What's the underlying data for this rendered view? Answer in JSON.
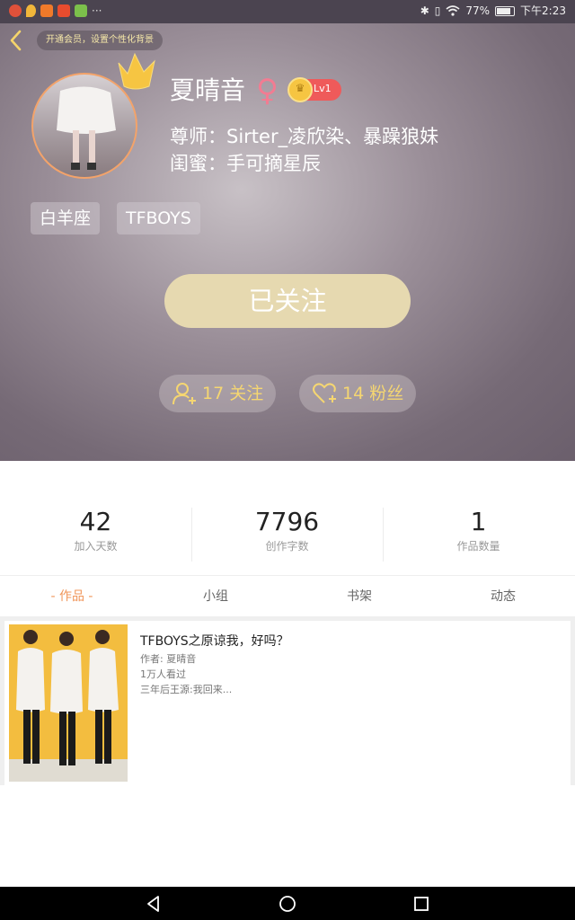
{
  "status_bar": {
    "left_icons": [
      "music-app-icon",
      "location-icon",
      "video-app-icon",
      "orange-app-icon",
      "green-app-icon"
    ],
    "overflow": "···",
    "battery_percent": "77%",
    "time": "下午2:23"
  },
  "header": {
    "vip_tip": "开通会员，设置个性化背景",
    "username": "夏晴音",
    "gender_symbol": "♀",
    "level": "Lv1",
    "mentor_line": "尊师：Sirter_凌欣染、暴躁狼妹",
    "bestie_line": "闺蜜：手可摘星辰",
    "tags": [
      "白羊座",
      "TFBOYS"
    ],
    "follow_button": "已关注",
    "following_count": "17 关注",
    "fans_count": "14 粉丝"
  },
  "stats": [
    {
      "value": "42",
      "label": "加入天数"
    },
    {
      "value": "7796",
      "label": "创作字数"
    },
    {
      "value": "1",
      "label": "作品数量"
    }
  ],
  "tabs": [
    "- 作品 -",
    "小组",
    "书架",
    "动态"
  ],
  "works": [
    {
      "title": "TFBOYS之原谅我，好吗？",
      "author": "作者: 夏晴音",
      "views": "1万人看过",
      "excerpt": "三年后王源:我回来..."
    }
  ],
  "colors": {
    "accent": "#f0965a",
    "follow_button": "#e6d9b0",
    "pill_text": "#f5d671",
    "level_badge": "#ef5a5a"
  }
}
